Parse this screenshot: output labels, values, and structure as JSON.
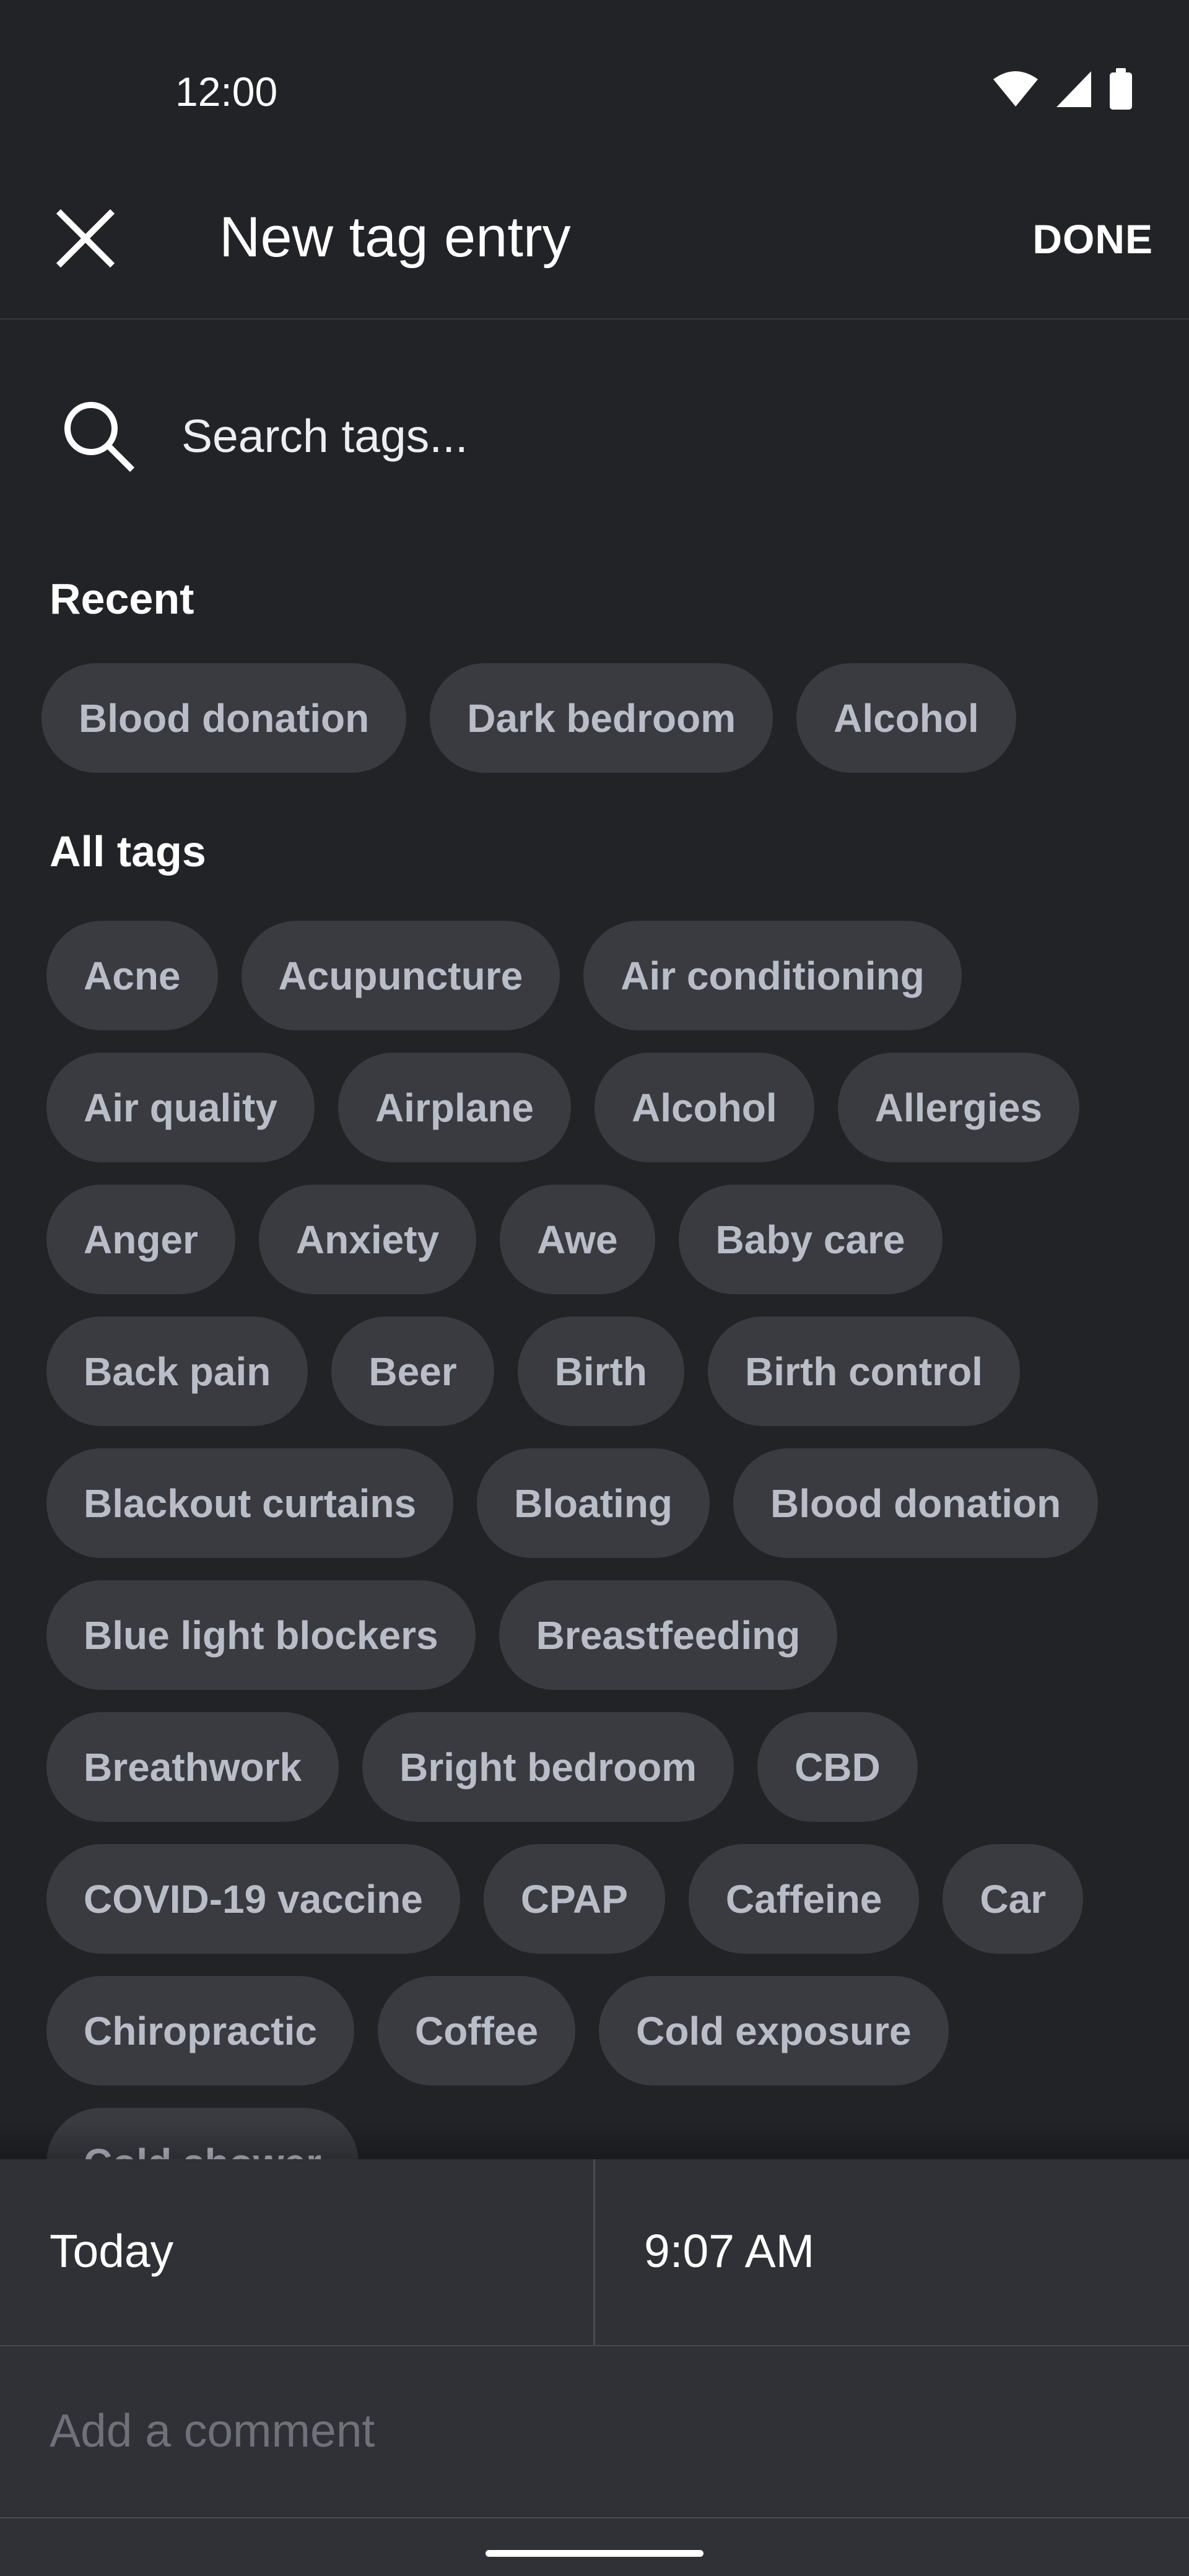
{
  "status_bar": {
    "time": "12:00",
    "icons": [
      "wifi-icon",
      "cell-signal-icon",
      "battery-icon"
    ]
  },
  "header": {
    "close_icon": "close-icon",
    "title": "New tag entry",
    "done_label": "DONE"
  },
  "search": {
    "icon": "search-icon",
    "placeholder": "Search tags..."
  },
  "recent": {
    "title": "Recent",
    "tags": [
      "Blood donation",
      "Dark bedroom",
      "Alcohol"
    ]
  },
  "all_tags": {
    "title": "All tags",
    "tags": [
      "Acne",
      "Acupuncture",
      "Air conditioning",
      "Air quality",
      "Airplane",
      "Alcohol",
      "Allergies",
      "Anger",
      "Anxiety",
      "Awe",
      "Baby care",
      "Back pain",
      "Beer",
      "Birth",
      "Birth control",
      "Blackout curtains",
      "Bloating",
      "Blood donation",
      "Blue light blockers",
      "Breastfeeding",
      "Breathwork",
      "Bright bedroom",
      "CBD",
      "COVID-19 vaccine",
      "CPAP",
      "Caffeine",
      "Car",
      "Chiropractic",
      "Coffee",
      "Cold exposure",
      "Cold shower"
    ]
  },
  "bottom": {
    "date": "Today",
    "time": "9:07 AM",
    "comment_placeholder": "Add a comment"
  },
  "colors": {
    "background": "#222327",
    "chip_background": "#3a3b41",
    "chip_text": "#b9bdc8",
    "panel_background": "#303136"
  }
}
